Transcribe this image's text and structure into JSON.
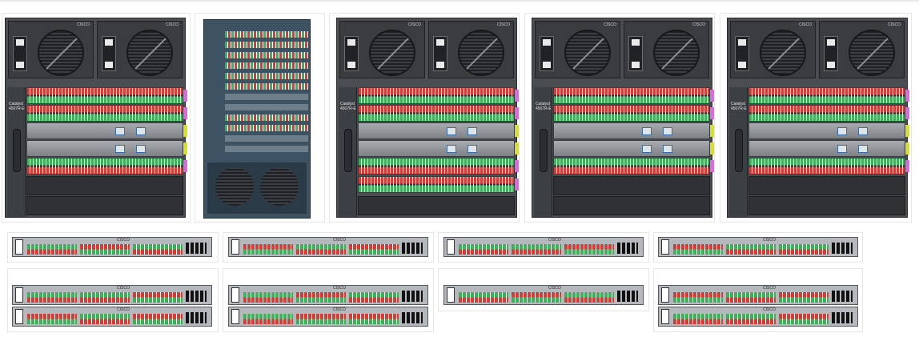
{
  "chassis_brand": "CISCO",
  "chassis_model": "Catalyst 4507R-E",
  "switch_model": "CISCO",
  "colors": {
    "port_red": "#d63b36",
    "port_green": "#3fb05a",
    "module_tag_magenta": "#d86be0",
    "module_tag_yellow": "#d7e12a",
    "chassis_grey": "#4a4d51",
    "rack_blue": "#3d5364"
  }
}
